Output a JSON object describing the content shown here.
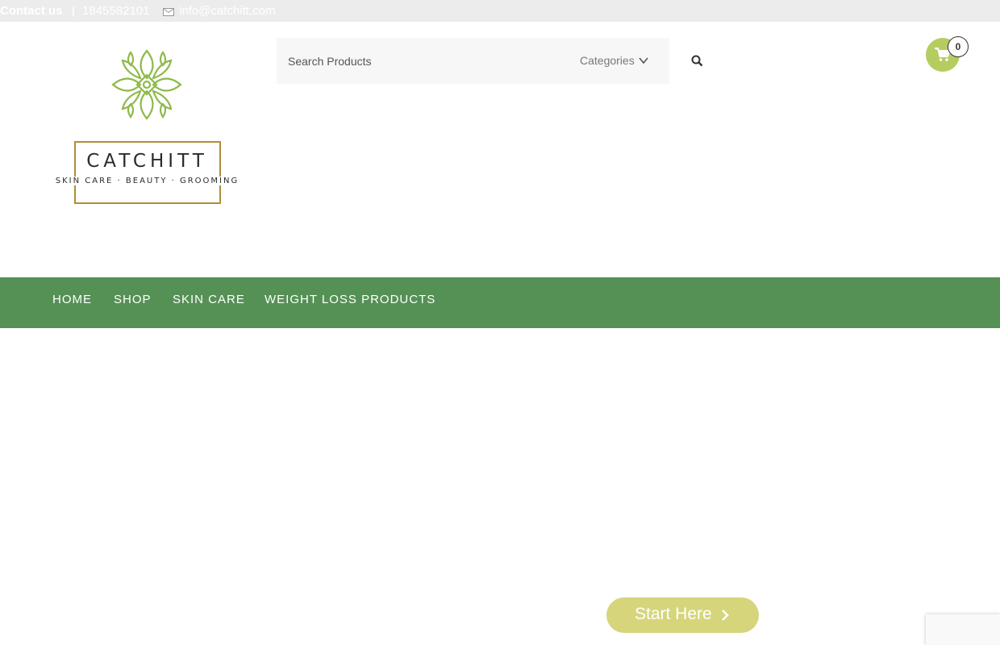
{
  "topbar": {
    "contact_label": "Contact us",
    "phone": "1845582101",
    "email": "info@catchitt.com",
    "icons": {
      "phone": "phone-icon",
      "mail": "mail-icon"
    }
  },
  "logo": {
    "brand": "CATCHITT",
    "tagline": "SKIN CARE · BEAUTY · GROOMING"
  },
  "search": {
    "placeholder": "Search Products",
    "categories_label": "Categories",
    "icons": {
      "search": "search-icon",
      "dropdown": "chevron-down-icon"
    }
  },
  "cart": {
    "count": "0",
    "icon": "shopping-cart-icon"
  },
  "nav": {
    "items": [
      {
        "label": "HOME"
      },
      {
        "label": "SHOP"
      },
      {
        "label": "SKIN CARE"
      },
      {
        "label": "WEIGHT LOSS PRODUCTS"
      }
    ]
  },
  "cta": {
    "label": "Start Here",
    "icon": "chevron-right-icon"
  },
  "colors": {
    "nav_green": "#559155",
    "accent_olive": "#b5cc60",
    "cta_yellow": "#d6d57b",
    "topbar_bg": "#ececec",
    "logo_leaf": "#8fb94a",
    "logo_gold": "#b08d3a"
  }
}
